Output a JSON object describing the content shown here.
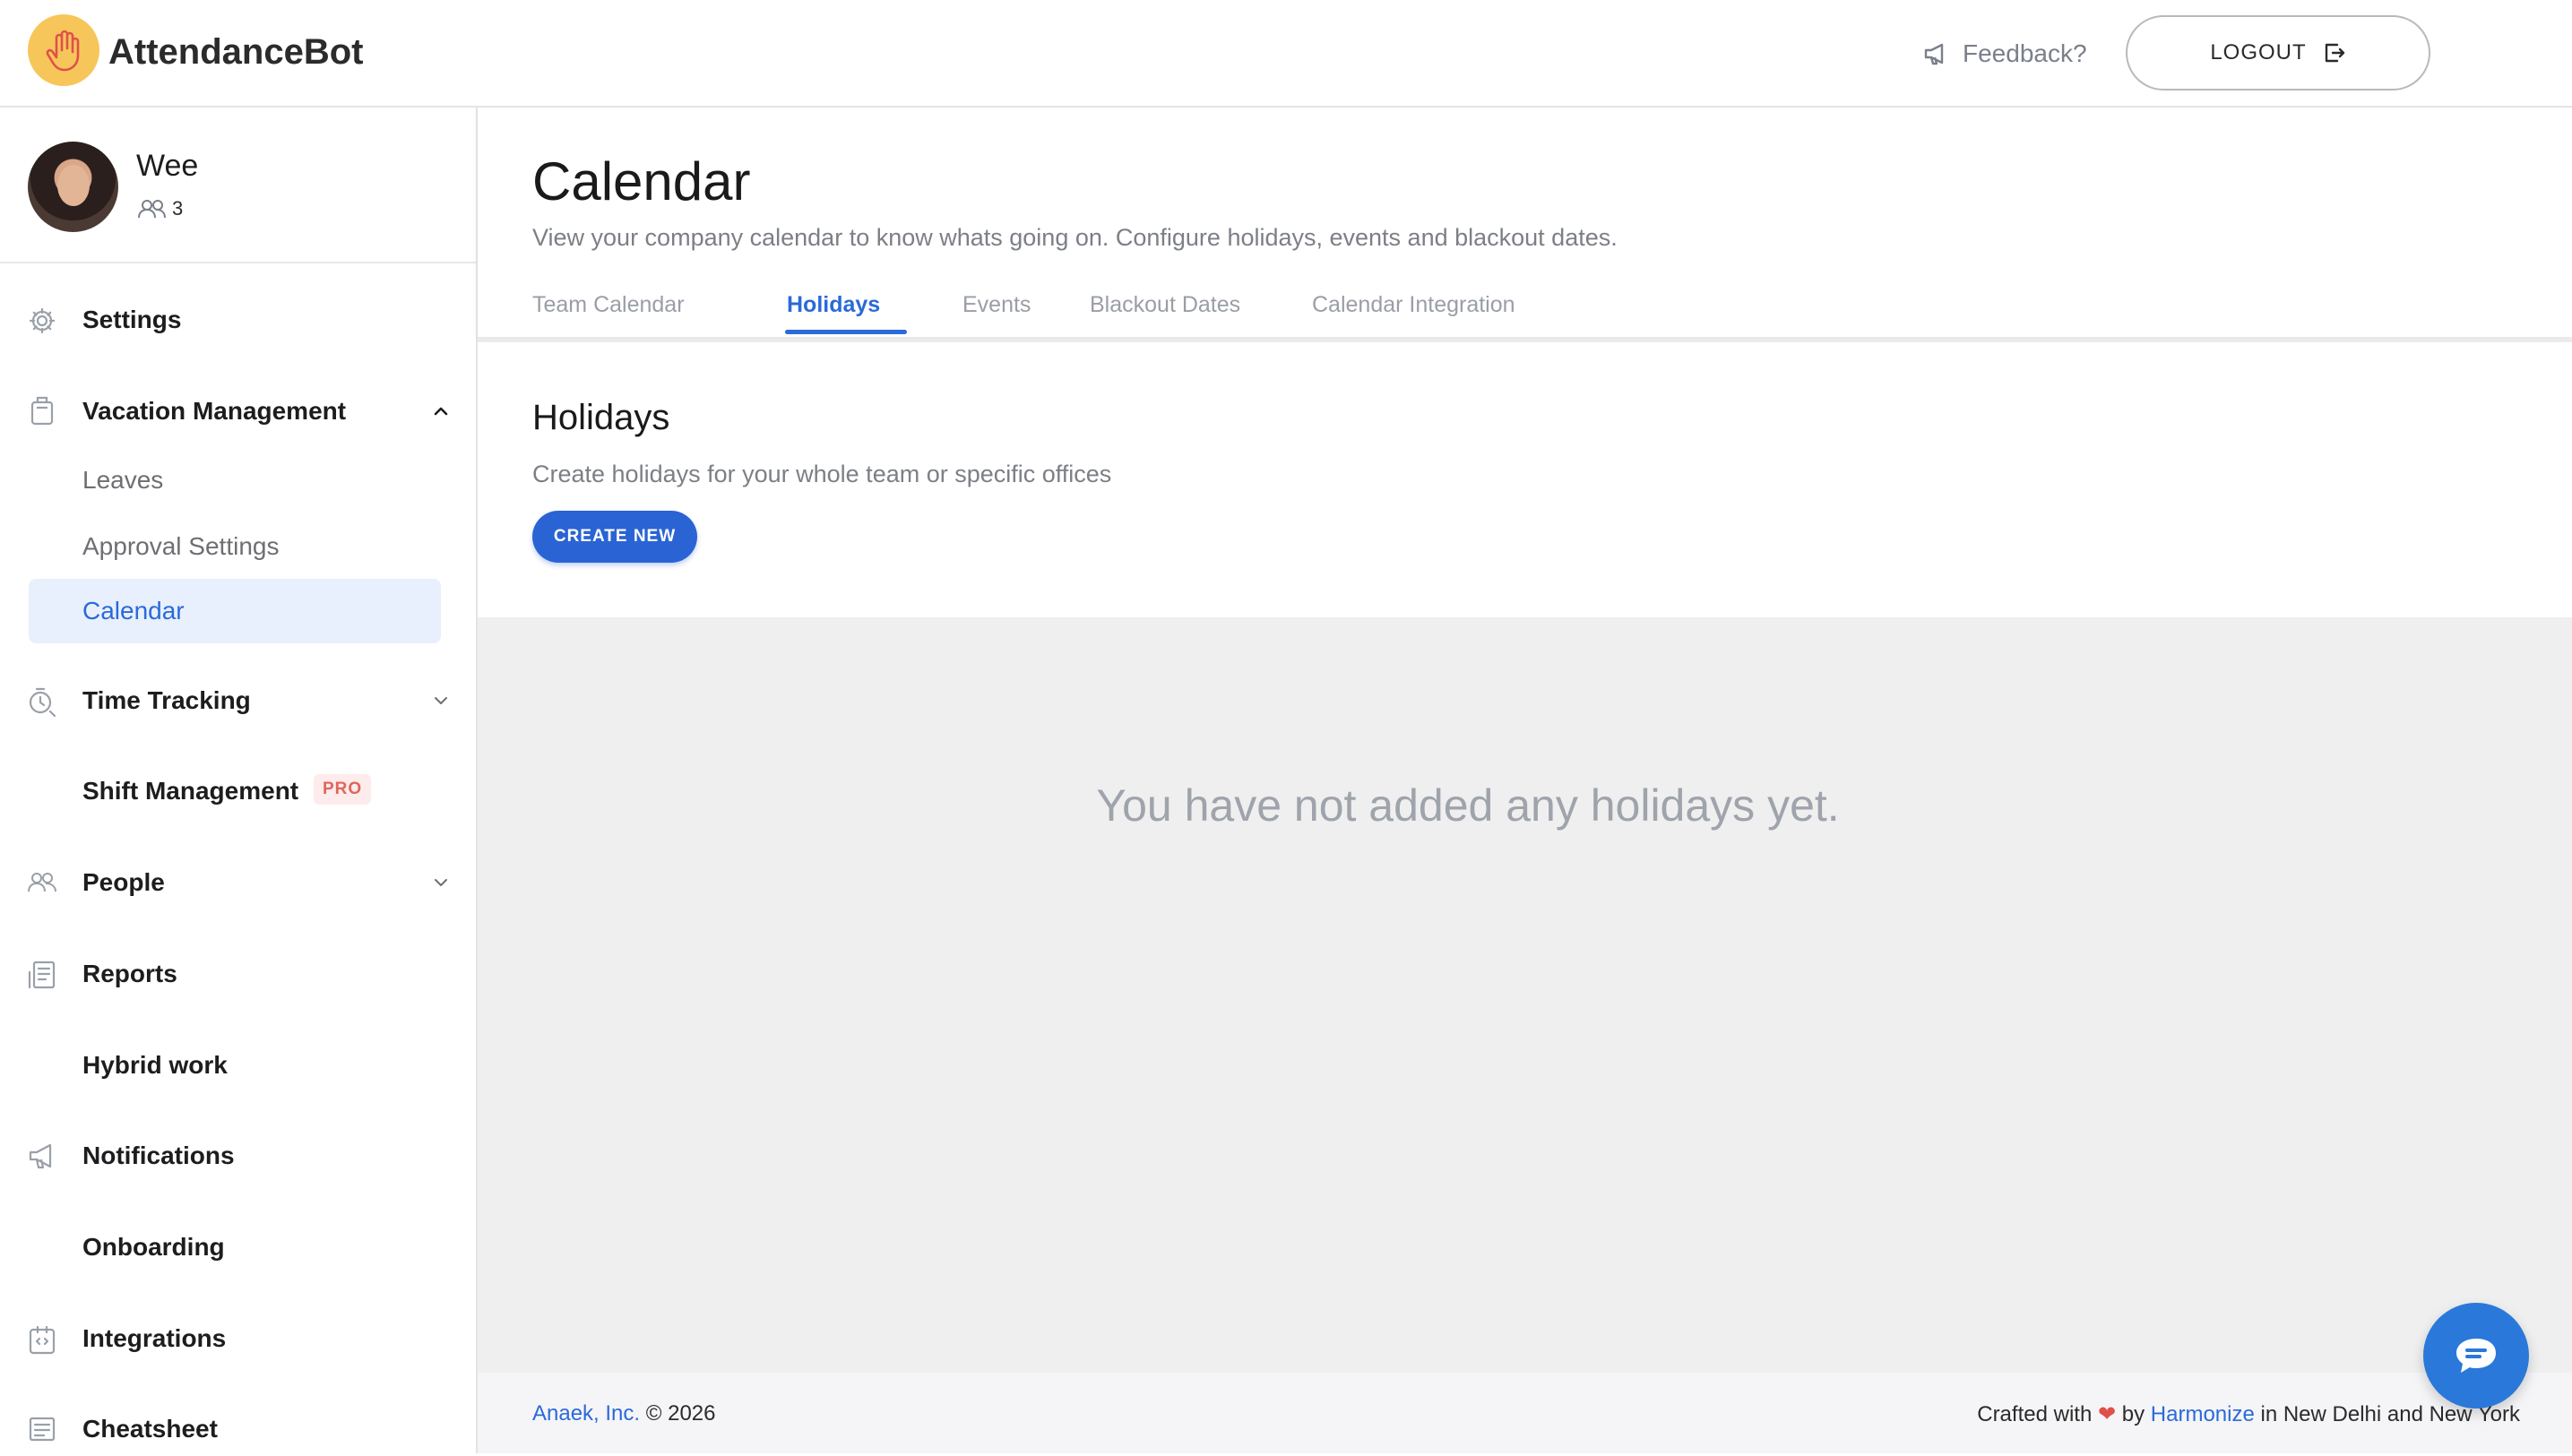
{
  "app": {
    "brand": "AttendanceBot",
    "feedback_label": "Feedback?",
    "logout_label": "LOGOUT"
  },
  "profile": {
    "name": "Wee",
    "team_count": "3"
  },
  "sidebar": {
    "items": [
      {
        "label": "Settings",
        "icon": "gear-icon"
      },
      {
        "label": "Vacation Management",
        "icon": "luggage-icon",
        "expanded": true
      },
      {
        "label": "Leaves"
      },
      {
        "label": "Approval Settings"
      },
      {
        "label": "Calendar",
        "active": true
      },
      {
        "label": "Time Tracking",
        "icon": "stopwatch-icon"
      },
      {
        "label": "Shift Management",
        "badge": "PRO"
      },
      {
        "label": "People",
        "icon": "people-icon"
      },
      {
        "label": "Reports",
        "icon": "report-icon"
      },
      {
        "label": "Hybrid work"
      },
      {
        "label": "Notifications",
        "icon": "megaphone-icon"
      },
      {
        "label": "Onboarding"
      },
      {
        "label": "Integrations",
        "icon": "integration-icon"
      },
      {
        "label": "Cheatsheet",
        "icon": "cheatsheet-icon"
      }
    ]
  },
  "page": {
    "title": "Calendar",
    "subtitle": "View your company calendar to know whats going on. Configure holidays, events and blackout dates.",
    "tabs": [
      {
        "label": "Team Calendar"
      },
      {
        "label": "Holidays",
        "active": true
      },
      {
        "label": "Events"
      },
      {
        "label": "Blackout Dates"
      },
      {
        "label": "Calendar Integration"
      }
    ]
  },
  "holidays": {
    "title": "Holidays",
    "subtitle": "Create holidays for your whole team or specific offices",
    "create_label": "CREATE NEW",
    "empty_message": "You have not added any holidays yet."
  },
  "footer": {
    "company": "Anaek, Inc.",
    "copyright": "© 2026",
    "crafted_prefix": "Crafted with",
    "crafted_by": "by",
    "partner": "Harmonize",
    "crafted_suffix": "in New Delhi and New York"
  },
  "colors": {
    "accent": "#2a6ad9",
    "logo_bg": "#f7c65a",
    "pro_badge": "#e0665a",
    "heart": "#e0504a"
  }
}
